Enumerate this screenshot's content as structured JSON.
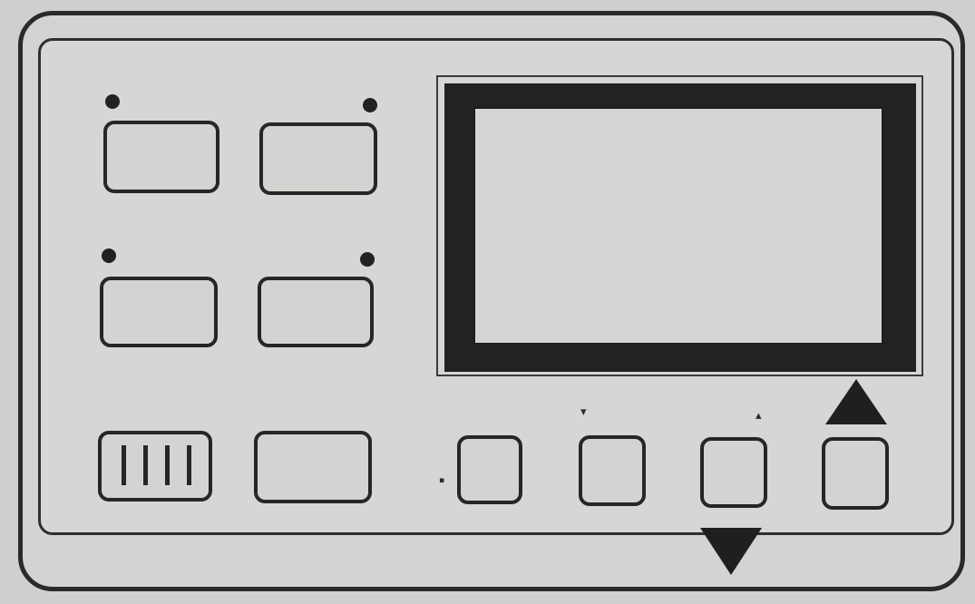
{
  "panel": {
    "indicator_glyphs": {
      "down_marker": "▾",
      "up_marker": "▴",
      "small_mark": "▪"
    },
    "arrows": {
      "up_arrow_icon": "triangle-up",
      "down_arrow_icon": "triangle-down"
    },
    "display": {
      "content": ""
    },
    "colors": {
      "panel_background": "#d3d3d1",
      "outline": "#262626",
      "display_bezel": "#222222"
    }
  }
}
